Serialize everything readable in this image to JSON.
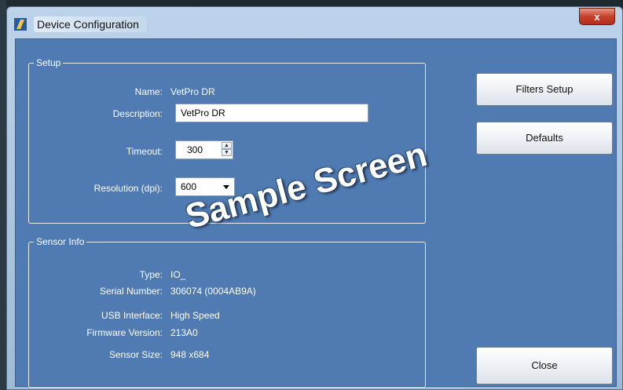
{
  "window": {
    "title": "Device Configuration",
    "close_glyph": "x"
  },
  "setup": {
    "group_title": "Setup",
    "name_label": "Name:",
    "name_value": "VetPro DR",
    "description_label": "Description:",
    "description_value": "VetPro DR",
    "timeout_label": "Timeout:",
    "timeout_value": "300",
    "resolution_label": "Resolution (dpi):",
    "resolution_value": "600"
  },
  "sensor_info": {
    "group_title": "Sensor Info",
    "rows": [
      {
        "label": "Type:",
        "value": "IO_"
      },
      {
        "label": "Serial Number:",
        "value": "306074 (0004AB9A)"
      },
      {
        "label": "USB Interface:",
        "value": "High Speed"
      },
      {
        "label": "Firmware Version:",
        "value": "213A0"
      },
      {
        "label": "Sensor Size:",
        "value": "948 x684"
      }
    ]
  },
  "buttons": {
    "filters_setup": "Filters Setup",
    "defaults": "Defaults",
    "close": "Close"
  },
  "watermark": "Sample Screen",
  "icons": {
    "app": "app-logo-icon",
    "close": "close-icon",
    "spin_up": "spin-up-icon",
    "spin_down": "spin-down-icon",
    "dropdown": "chevron-down-icon"
  },
  "colors": {
    "client_background": "#4f7ab2",
    "close_button": "#c5402a"
  }
}
